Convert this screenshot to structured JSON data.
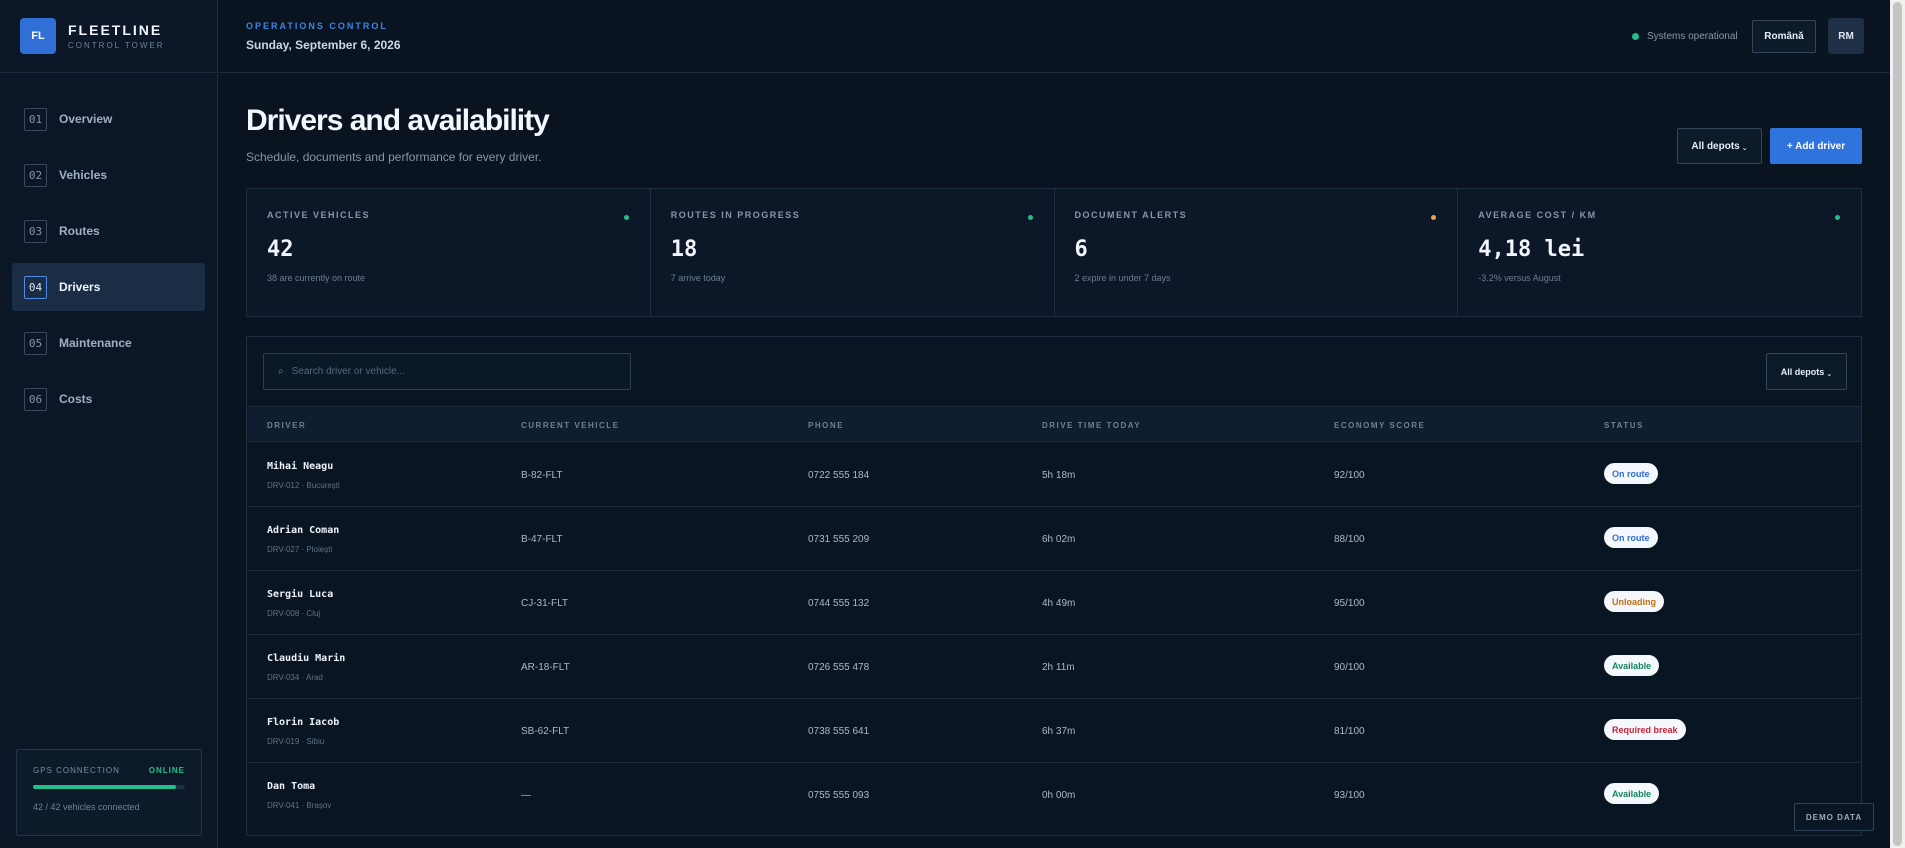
{
  "brand": {
    "logo": "FL",
    "name": "FLEETLINE",
    "sub": "CONTROL TOWER"
  },
  "nav": [
    {
      "num": "01",
      "label": "Overview"
    },
    {
      "num": "02",
      "label": "Vehicles"
    },
    {
      "num": "03",
      "label": "Routes"
    },
    {
      "num": "04",
      "label": "Drivers"
    },
    {
      "num": "05",
      "label": "Maintenance"
    },
    {
      "num": "06",
      "label": "Costs"
    }
  ],
  "gps": {
    "title": "GPS CONNECTION",
    "status": "ONLINE",
    "count": "42 / 42 vehicles connected",
    "progress": 1.0
  },
  "header": {
    "section": "OPERATIONS CONTROL",
    "date": "Sunday, September 6, 2026",
    "system_status": "Systems operational",
    "language": "Română",
    "user_initials": "RM"
  },
  "page": {
    "title": "Drivers and availability",
    "subtitle": "Schedule, documents and performance for every driver.",
    "depot_filter": "All depots",
    "add_button": "+ Add driver"
  },
  "kpis": [
    {
      "label": "ACTIVE VEHICLES",
      "value": "42",
      "note": "38 are currently on route",
      "color": "#22c08a"
    },
    {
      "label": "ROUTES IN PROGRESS",
      "value": "18",
      "note": "7 arrive today",
      "color": "#22c08a"
    },
    {
      "label": "DOCUMENT ALERTS",
      "value": "6",
      "note": "2 expire in under 7 days",
      "color": "#f0a13a"
    },
    {
      "label": "AVERAGE COST / KM",
      "value": "4,18 lei",
      "note": "-3.2% versus August",
      "color": "#22c08a"
    }
  ],
  "table": {
    "search_placeholder": "Search driver or vehicle...",
    "depot_filter": "All depots",
    "columns": [
      "DRIVER",
      "CURRENT VEHICLE",
      "PHONE",
      "DRIVE TIME TODAY",
      "ECONOMY SCORE",
      "STATUS"
    ],
    "rows": [
      {
        "name": "Mihai Neagu",
        "meta": "DRV-012 · București",
        "vehicle": "B-82-FLT",
        "phone": "0722 555 184",
        "drive_time": "5h 18m",
        "score": "92/100",
        "status": "On route",
        "status_color": "#2f6fd6"
      },
      {
        "name": "Adrian Coman",
        "meta": "DRV-027 · Ploiești",
        "vehicle": "B-47-FLT",
        "phone": "0731 555 209",
        "drive_time": "6h 02m",
        "score": "88/100",
        "status": "On route",
        "status_color": "#2f6fd6"
      },
      {
        "name": "Sergiu Luca",
        "meta": "DRV-008 · Cluj",
        "vehicle": "CJ-31-FLT",
        "phone": "0744 555 132",
        "drive_time": "4h 49m",
        "score": "95/100",
        "status": "Unloading",
        "status_color": "#c46d12"
      },
      {
        "name": "Claudiu Marin",
        "meta": "DRV-034 · Arad",
        "vehicle": "AR-18-FLT",
        "phone": "0726 555 478",
        "drive_time": "2h 11m",
        "score": "90/100",
        "status": "Available",
        "status_color": "#14875d"
      },
      {
        "name": "Florin Iacob",
        "meta": "DRV-019 · Sibiu",
        "vehicle": "SB-62-FLT",
        "phone": "0738 555 641",
        "drive_time": "6h 37m",
        "score": "81/100",
        "status": "Required break",
        "status_color": "#c8233a"
      },
      {
        "name": "Dan Toma",
        "meta": "DRV-041 · Brașov",
        "vehicle": "—",
        "phone": "0755 555 093",
        "drive_time": "0h 00m",
        "score": "93/100",
        "status": "Available",
        "status_color": "#14875d"
      }
    ]
  },
  "demo_label": "DEMO DATA",
  "icons": {
    "search": "search-icon",
    "chevron": "chevron-down-icon"
  }
}
